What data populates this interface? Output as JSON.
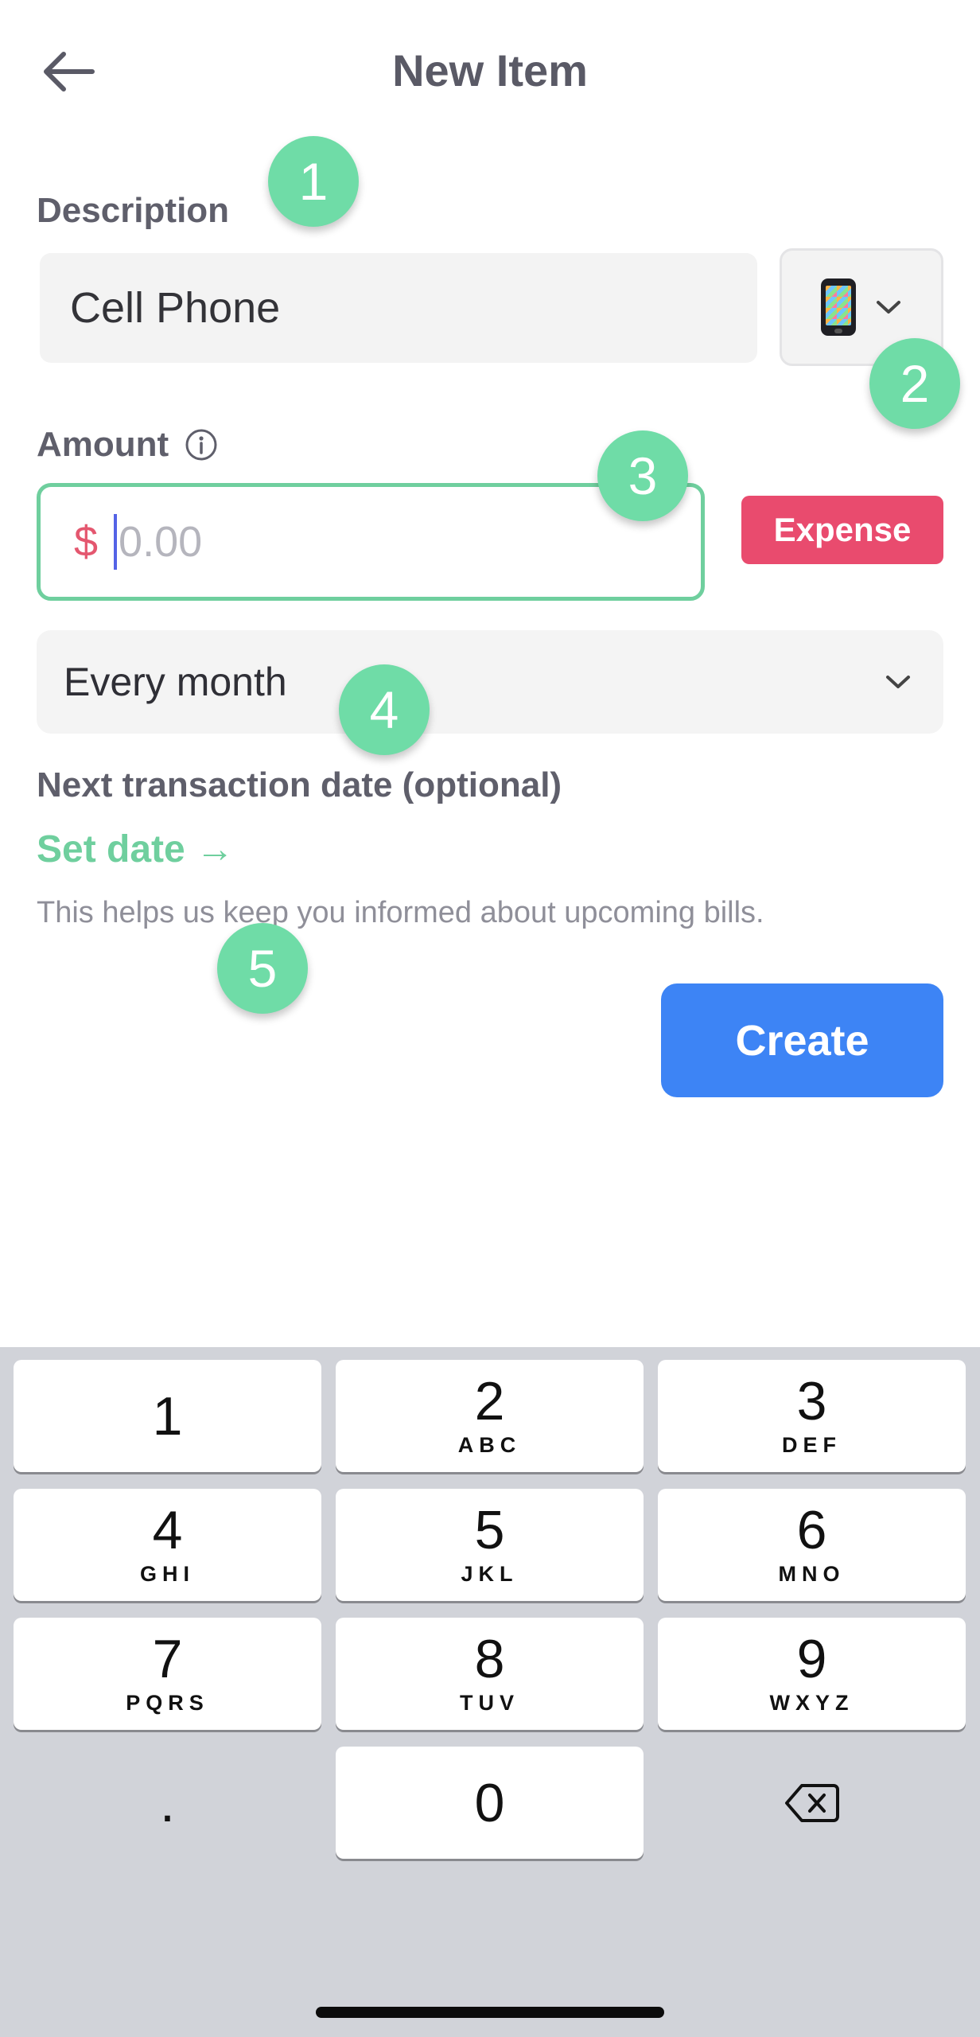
{
  "header": {
    "title": "New Item"
  },
  "description": {
    "label": "Description",
    "value": "Cell Phone",
    "icon": "mobile-phone-icon"
  },
  "amount": {
    "label": "Amount",
    "currency_symbol": "$",
    "placeholder": "0.00",
    "value": "",
    "type_label": "Expense"
  },
  "frequency": {
    "selected": "Every month"
  },
  "next_date": {
    "label": "Next transaction date (optional)",
    "link": "Set date →",
    "help": "This helps us keep you informed about upcoming bills."
  },
  "actions": {
    "create_label": "Create"
  },
  "markers": [
    "1",
    "2",
    "3",
    "4",
    "5"
  ],
  "keypad": {
    "keys": [
      {
        "num": "1",
        "letters": ""
      },
      {
        "num": "2",
        "letters": "ABC"
      },
      {
        "num": "3",
        "letters": "DEF"
      },
      {
        "num": "4",
        "letters": "GHI"
      },
      {
        "num": "5",
        "letters": "JKL"
      },
      {
        "num": "6",
        "letters": "MNO"
      },
      {
        "num": "7",
        "letters": "PQRS"
      },
      {
        "num": "8",
        "letters": "TUV"
      },
      {
        "num": "9",
        "letters": "WXYZ"
      },
      {
        "num": ".",
        "letters": ""
      },
      {
        "num": "0",
        "letters": ""
      }
    ]
  },
  "colors": {
    "accent_green": "#6fcf9e",
    "expense_red": "#e94b6e",
    "primary_blue": "#3d84f5",
    "marker_green": "#6fdca7"
  }
}
